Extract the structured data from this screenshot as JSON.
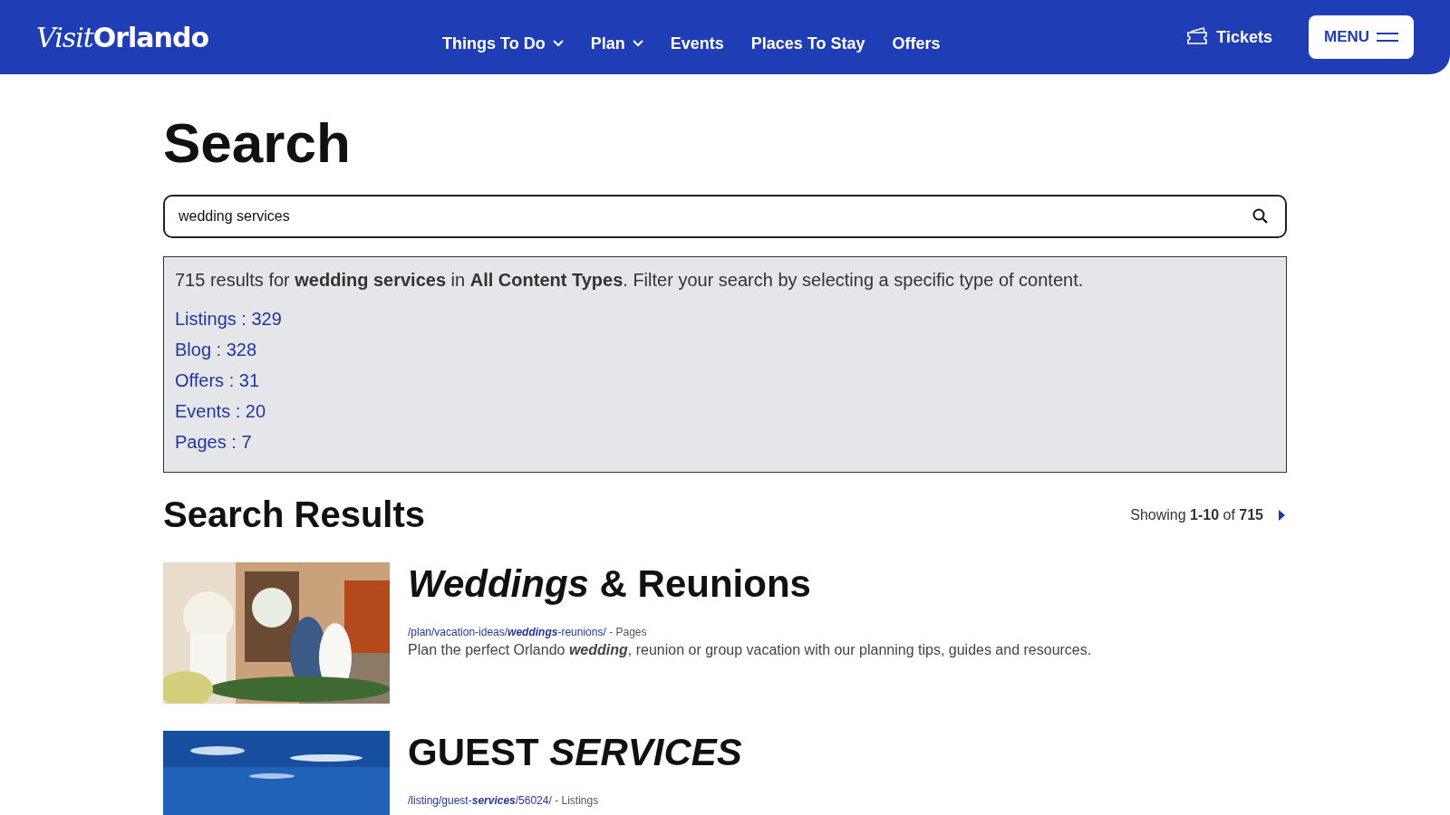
{
  "header": {
    "logo": {
      "script": "Visit",
      "word": "Orlando"
    },
    "nav": [
      {
        "label": "Things To Do",
        "dropdown": true
      },
      {
        "label": "Plan",
        "dropdown": true
      },
      {
        "label": "Events",
        "dropdown": false
      },
      {
        "label": "Places To Stay",
        "dropdown": false
      },
      {
        "label": "Offers",
        "dropdown": false
      }
    ],
    "tickets": "Tickets",
    "menu": "MENU"
  },
  "title": "Search",
  "search": {
    "value": "wedding services"
  },
  "summary": "715 results for **wedding services** in **All Content Types**. Filter your search by selecting a specific type of content.",
  "filters": [
    "Listings : 329",
    "Blog : 328",
    "Offers : 31",
    "Events : 20",
    "Pages : 7"
  ],
  "results_heading": "Search Results",
  "showing": "Showing **1-10** of **715**",
  "results": [
    {
      "kind": "picture",
      "title": "*Weddings* & Reunions",
      "url": "/plan/vacation-ideas/*weddings*-reunions/",
      "type": " - Pages",
      "description": "Plan the perfect Orlando *wedding*, reunion or group vacation with our planning tips, guides and resources."
    },
    {
      "kind": "picture",
      "title": "GUEST *SERVICES*",
      "url": "/listing/guest-*services*/56024/",
      "type": " - Listings"
    }
  ]
}
